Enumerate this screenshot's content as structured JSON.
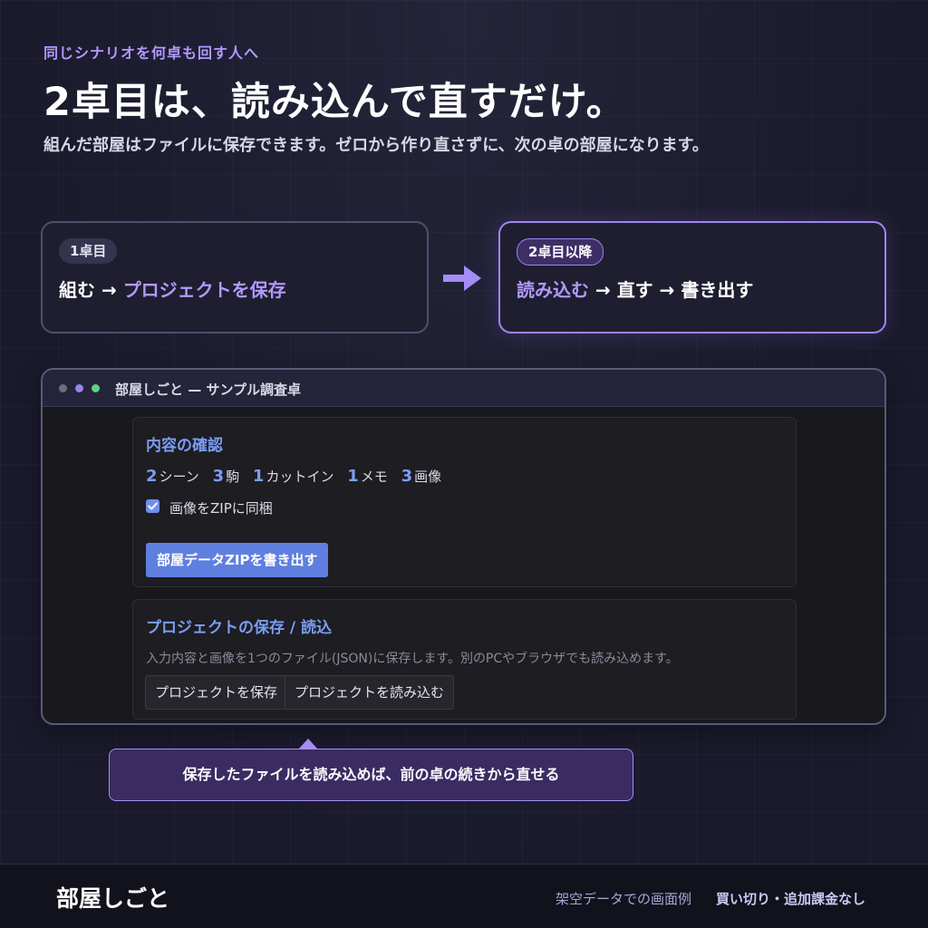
{
  "header": {
    "eyebrow": "同じシナリオを何卓も回す人へ",
    "headline": "2卓目は、読み込んで直すだけ。",
    "subline": "組んだ部屋はファイルに保存できます。ゼロから作り直さずに、次の卓の部屋になります。"
  },
  "steps": [
    {
      "badge": "1卓目",
      "action1": "組む",
      "arrow1": " → ",
      "action2": "プロジェクトを保存"
    },
    {
      "badge": "2卓目以降",
      "action1": "読み込む",
      "arrow1": " → ",
      "action2": "直す",
      "arrow2": " → ",
      "action3": "書き出す"
    }
  ],
  "flow_arrow_icon": "arrow-right-icon",
  "window": {
    "title": "部屋しごと — サンプル調査卓",
    "dot_colors": [
      "#6e6e82",
      "#9d82ee",
      "#5fd08a"
    ],
    "summary": {
      "title": "内容の確認",
      "stats": [
        {
          "count": "2",
          "label": "シーン"
        },
        {
          "count": "3",
          "label": "駒"
        },
        {
          "count": "1",
          "label": "カットイン"
        },
        {
          "count": "1",
          "label": "メモ"
        },
        {
          "count": "3",
          "label": "画像"
        }
      ],
      "checkbox_label": "画像をZIPに同梱",
      "checkbox_checked": true,
      "export_button": "部屋データZIPを書き出す"
    },
    "project": {
      "title": "プロジェクトの保存 / 読込",
      "description": "入力内容と画像を1つのファイル(JSON)に保存します。別のPCやブラウザでも読み込めます。",
      "save_button": "プロジェクトを保存",
      "load_button": "プロジェクトを読み込む"
    }
  },
  "callout": "保存したファイルを読み込めば、前の卓の続きから直せる",
  "footer": {
    "brand": "部屋しごと",
    "note1": "架空データでの画面例",
    "note2": "買い切り・追加課金なし"
  },
  "colors": {
    "accent_purple": "#b399ff",
    "accent_blue": "#7c9df5",
    "button_blue": "#5f7fe0",
    "background": "#1b1b2d"
  }
}
